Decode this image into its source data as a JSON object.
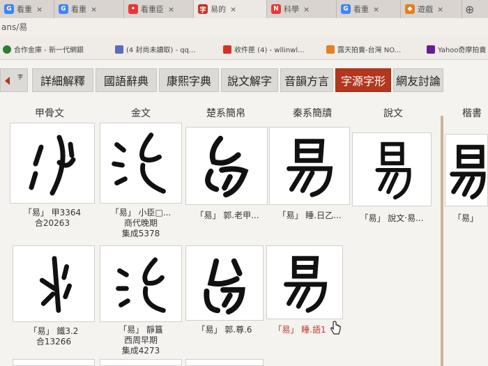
{
  "browser": {
    "tabs": [
      {
        "label": "看重",
        "icon": "chrome-icon",
        "color": "#4285f4"
      },
      {
        "label": "看重",
        "icon": "chrome-icon",
        "color": "#4285f4"
      },
      {
        "label": "看重臣",
        "icon": "red-badge-icon",
        "color": "#e53935"
      },
      {
        "label": "易的",
        "icon": "dictionary-icon",
        "color": "#c0392b"
      },
      {
        "label": "科學",
        "icon": "news-icon",
        "color": "#e53935"
      },
      {
        "label": "看重",
        "icon": "chrome-icon",
        "color": "#4285f4"
      },
      {
        "label": "遊戲",
        "icon": "auction-icon",
        "color": "#e67e22"
      }
    ],
    "address_text": "ans/易",
    "bookmarks": [
      {
        "label": "合作金庫 - 新一代網銀",
        "icon": "bank-icon",
        "color": "#2e7d32"
      },
      {
        "label": "(4 封尚未讀取) - qq...",
        "icon": "mail-icon",
        "color": "#5c6bc0"
      },
      {
        "label": "收件匣 (4) - wllinwl...",
        "icon": "gmail-icon",
        "color": "#d93025"
      },
      {
        "label": "露天拍賣-台灣 NO...",
        "icon": "auction-icon",
        "color": "#e67e22"
      },
      {
        "label": "Yahoo奇摩拍賣",
        "icon": "yahoo-icon",
        "color": "#6a1b9a"
      }
    ]
  },
  "dictionary_tabs": [
    "詳細解釋",
    "國語辭典",
    "康熙字典",
    "說文解字",
    "音韻方言",
    "字源字形",
    "網友討論"
  ],
  "active_tab": "字源字形",
  "columns": [
    "甲骨文",
    "金文",
    "楚系簡帛",
    "秦系簡牘",
    "說文",
    "楷書"
  ],
  "row1": [
    {
      "caption_lines": [
        "「易」 甲3364",
        "合20263"
      ],
      "red": false
    },
    {
      "caption_lines": [
        "「易」 小臣□...",
        "商代晚期",
        "集成5378"
      ],
      "red": false
    },
    {
      "caption_lines": [
        "「易」 郭.老甲..."
      ],
      "red": false
    },
    {
      "caption_lines": [
        "「易」 睡.日乙..."
      ],
      "red": false
    },
    {
      "caption_lines": [
        "「易」 說文‧易..."
      ],
      "red": false
    },
    {
      "caption_lines": [
        "「易」"
      ],
      "red": false
    }
  ],
  "row2": [
    {
      "caption_lines": [
        "「易」 鐵3.2",
        "合13266"
      ],
      "red": false
    },
    {
      "caption_lines": [
        "「易」 靜簋",
        "西周早期",
        "集成4273"
      ],
      "red": false
    },
    {
      "caption_lines": [
        "「易」 郭.尊.6"
      ],
      "red": false
    },
    {
      "caption_lines": [
        "「易」 睡.語1"
      ],
      "red": true
    }
  ],
  "colors": {
    "active_tab": "#b3361f",
    "divider": "#c9b49b",
    "highlight_caption": "#c0392b"
  }
}
